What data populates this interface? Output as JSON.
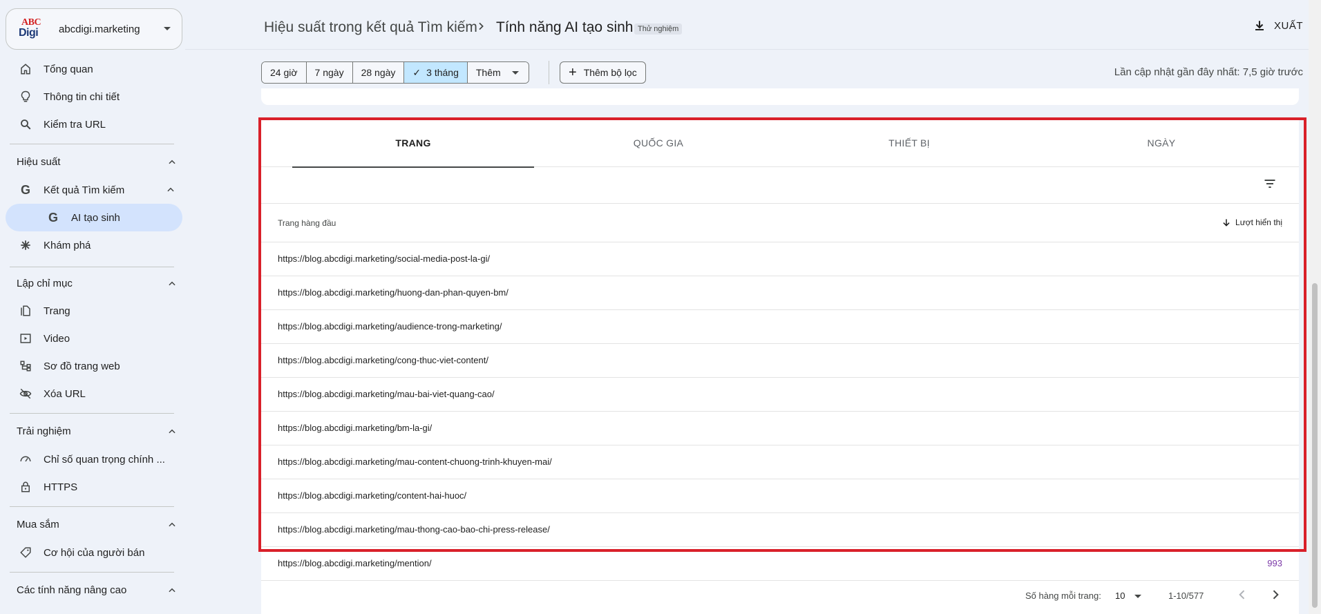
{
  "property": {
    "name": "abcdigi.marketing",
    "logo_top": "ABC",
    "logo_bottom": "Digi"
  },
  "sidebar": {
    "overview": "Tổng quan",
    "insights": "Thông tin chi tiết",
    "url_inspection": "Kiểm tra URL",
    "performance_section": "Hiệu suất",
    "search_results": "Kết quả Tìm kiếm",
    "ai_generative": "AI tạo sinh",
    "discover": "Khám phá",
    "indexing_section": "Lập chỉ mục",
    "pages": "Trang",
    "video": "Video",
    "sitemaps": "Sơ đồ trang web",
    "removals": "Xóa URL",
    "experience_section": "Trải nghiệm",
    "core_web_vitals": "Chỉ số quan trọng chính ...",
    "https": "HTTPS",
    "shopping_section": "Mua sắm",
    "merchant": "Cơ hội của người bán",
    "advanced_section": "Các tính năng nâng cao",
    "g_letter": "G"
  },
  "header": {
    "breadcrumb_parent": "Hiệu suất trong kết quả Tìm kiếm",
    "breadcrumb_current": "Tính năng AI tạo sinh",
    "badge": "Thử nghiệm",
    "export": "XUẤT"
  },
  "filters": {
    "ranges": [
      "24 giờ",
      "7 ngày",
      "28 ngày",
      "3 tháng"
    ],
    "selected_check": "✓",
    "more": "Thêm",
    "add_filter": "Thêm bộ lọc",
    "last_updated": "Lần cập nhật gần đây nhất: 7,5 giờ trước"
  },
  "tabs": [
    "TRANG",
    "QUỐC GIA",
    "THIẾT BỊ",
    "NGÀY"
  ],
  "table": {
    "col_page": "Trang hàng đầu",
    "col_metric": "Lượt hiển thị",
    "rows": [
      {
        "url": "https://blog.abcdigi.marketing/social-media-post-la-gi/",
        "value": ""
      },
      {
        "url": "https://blog.abcdigi.marketing/huong-dan-phan-quyen-bm/",
        "value": ""
      },
      {
        "url": "https://blog.abcdigi.marketing/audience-trong-marketing/",
        "value": ""
      },
      {
        "url": "https://blog.abcdigi.marketing/cong-thuc-viet-content/",
        "value": ""
      },
      {
        "url": "https://blog.abcdigi.marketing/mau-bai-viet-quang-cao/",
        "value": ""
      },
      {
        "url": "https://blog.abcdigi.marketing/bm-la-gi/",
        "value": ""
      },
      {
        "url": "https://blog.abcdigi.marketing/mau-content-chuong-trinh-khuyen-mai/",
        "value": ""
      },
      {
        "url": "https://blog.abcdigi.marketing/content-hai-huoc/",
        "value": ""
      },
      {
        "url": "https://blog.abcdigi.marketing/mau-thong-cao-bao-chi-press-release/",
        "value": ""
      },
      {
        "url": "https://blog.abcdigi.marketing/mention/",
        "value": "993"
      }
    ]
  },
  "pagination": {
    "rows_per_page_label": "Số hàng mỗi trang:",
    "rows_per_page": "10",
    "range": "1-10/577"
  },
  "colors": {
    "highlight": "#d9202a",
    "active_nav": "#d3e3fd",
    "selected_chip": "#c2e7ff",
    "metric": "#7c3aa8"
  }
}
